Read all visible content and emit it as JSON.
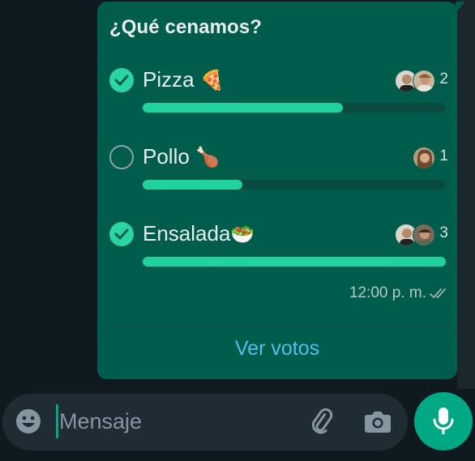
{
  "poll": {
    "title": "¿Qué cenamos?",
    "options": [
      {
        "label": "Pizza",
        "emoji": "🍕",
        "checked": true,
        "votes": "2",
        "fraction": 0.66
      },
      {
        "label": "Pollo",
        "emoji": "🍗",
        "checked": false,
        "votes": "1",
        "fraction": 0.33
      },
      {
        "label": "Ensalada",
        "emoji": "🥗",
        "checked": true,
        "votes": "3",
        "fraction": 1.0
      }
    ],
    "timestamp": "12:00 p. m.",
    "view_votes_label": "Ver votos"
  },
  "composer": {
    "placeholder": "Mensaje"
  },
  "colors": {
    "bubble": "#005c4b",
    "accent": "#21d19f",
    "link": "#53bdeb",
    "send": "#00a884"
  }
}
